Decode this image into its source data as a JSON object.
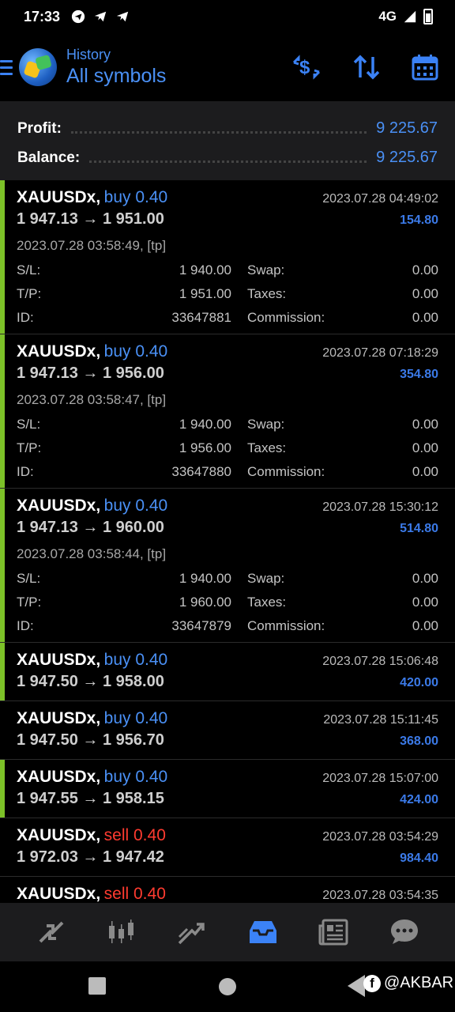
{
  "status_bar": {
    "time": "17:33",
    "network": "4G",
    "icons": [
      "telegram-icon",
      "telegram-send-icon",
      "telegram-send-icon",
      "signal-icon",
      "battery-icon"
    ]
  },
  "header": {
    "subtitle": "History",
    "title": "All symbols",
    "actions": [
      "currency-exchange-icon",
      "sort-icon",
      "calendar-icon"
    ]
  },
  "summary": {
    "profit_label": "Profit:",
    "profit_value": "9 225.67",
    "balance_label": "Balance:",
    "balance_value": "9 225.67"
  },
  "labels": {
    "sl": "S/L:",
    "tp": "T/P:",
    "id": "ID:",
    "swap": "Swap:",
    "taxes": "Taxes:",
    "commission": "Commission:"
  },
  "trades": [
    {
      "symbol": "XAUUSDx,",
      "side": "buy 0.40",
      "close_time": "2023.07.28 04:49:02",
      "prices": "1 947.13 → 1 951.00",
      "profit": "154.80",
      "open_info": "2023.07.28 03:58:49, [tp]",
      "sl": "1 940.00",
      "tp": "1 951.00",
      "id": "33647881",
      "swap": "0.00",
      "taxes": "0.00",
      "commission": "0.00"
    },
    {
      "symbol": "XAUUSDx,",
      "side": "buy 0.40",
      "close_time": "2023.07.28 07:18:29",
      "prices": "1 947.13 → 1 956.00",
      "profit": "354.80",
      "open_info": "2023.07.28 03:58:47, [tp]",
      "sl": "1 940.00",
      "tp": "1 956.00",
      "id": "33647880",
      "swap": "0.00",
      "taxes": "0.00",
      "commission": "0.00"
    },
    {
      "symbol": "XAUUSDx,",
      "side": "buy 0.40",
      "close_time": "2023.07.28 15:30:12",
      "prices": "1 947.13 → 1 960.00",
      "profit": "514.80",
      "open_info": "2023.07.28 03:58:44, [tp]",
      "sl": "1 940.00",
      "tp": "1 960.00",
      "id": "33647879",
      "swap": "0.00",
      "taxes": "0.00",
      "commission": "0.00"
    },
    {
      "symbol": "XAUUSDx,",
      "side": "buy 0.40",
      "close_time": "2023.07.28 15:06:48",
      "prices": "1 947.50 → 1 958.00",
      "profit": "420.00"
    },
    {
      "symbol": "XAUUSDx,",
      "side": "buy 0.40",
      "close_time": "2023.07.28 15:11:45",
      "prices": "1 947.50 → 1 956.70",
      "profit": "368.00"
    },
    {
      "symbol": "XAUUSDx,",
      "side": "buy 0.40",
      "close_time": "2023.07.28 15:07:00",
      "prices": "1 947.55 → 1 958.15",
      "profit": "424.00"
    },
    {
      "symbol": "XAUUSDx,",
      "side": "sell 0.40",
      "close_time": "2023.07.28 03:54:29",
      "prices": "1 972.03 → 1 947.42",
      "profit": "984.40"
    },
    {
      "symbol": "XAUUSDx,",
      "side": "sell 0.40",
      "close_time": "2023.07.28 03:54:35",
      "prices": "",
      "profit": ""
    }
  ],
  "bottom_nav": [
    "quotes-icon",
    "chart-icon",
    "trade-icon",
    "history-icon",
    "news-icon",
    "chat-icon"
  ],
  "watermark": "@AKBAR",
  "colors": {
    "accent": "#4a90f5",
    "sell": "#ff3b30",
    "profit_bar": "#7cc128"
  }
}
